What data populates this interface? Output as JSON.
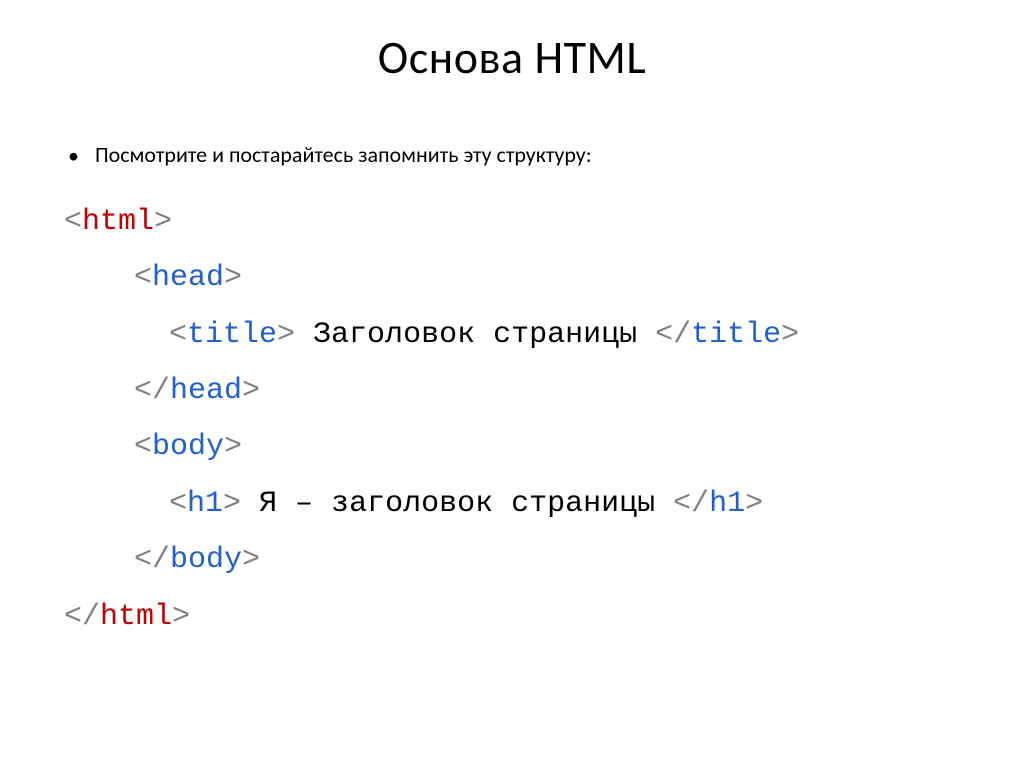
{
  "title": "Основа HTML",
  "bullet": "Посмотрите и постарайтесь запомнить эту структуру:",
  "code": {
    "open_html_tag": "html",
    "open_head_tag": "head",
    "title_tag": "title",
    "title_text": " Заголовок страницы ",
    "close_head_tag": "head",
    "open_body_tag": "body",
    "h1_tag": "h1",
    "h1_text": " Я – заголовок страницы ",
    "close_body_tag": "body",
    "close_html_tag": "html",
    "lt": "<",
    "gt": ">",
    "lts": "</"
  }
}
